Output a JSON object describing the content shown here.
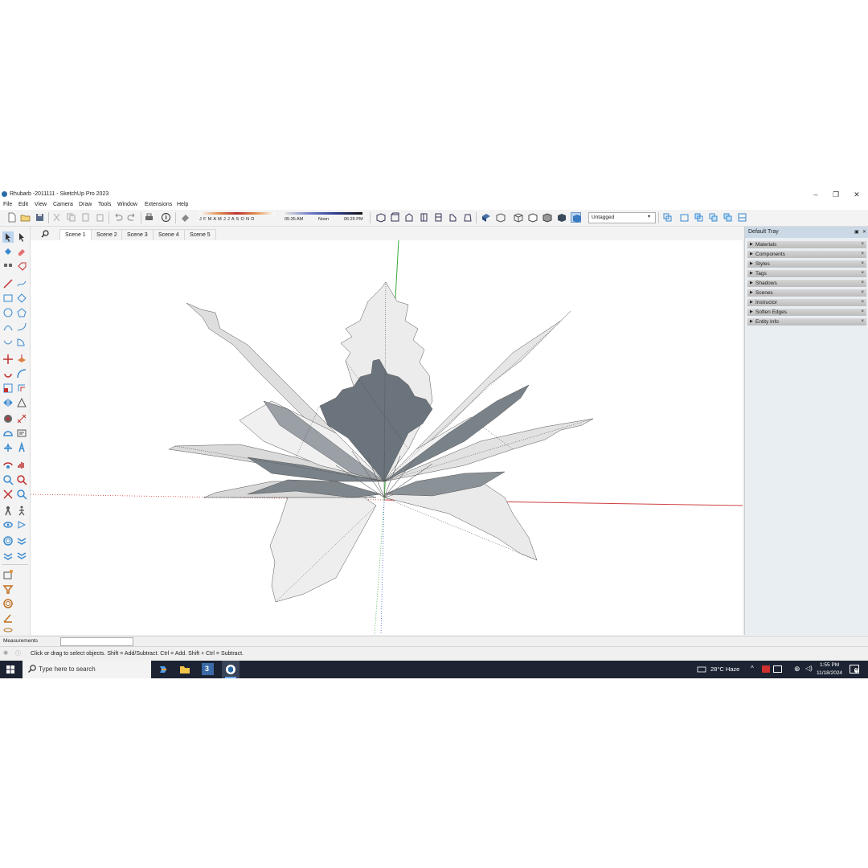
{
  "window": {
    "title": "Rhubarb -2011111 - SketchUp Pro 2023",
    "minimize": "–",
    "restore": "❐",
    "close": "✕"
  },
  "menu": [
    "File",
    "Edit",
    "View",
    "Camera",
    "Draw",
    "Tools",
    "Window",
    "Extensions",
    "Help"
  ],
  "shadows": {
    "months": "J F M A M J J A S O N D",
    "time_start": "05:35 AM",
    "time_mid": "Noon",
    "time_end": "06:25 PM"
  },
  "tag_select": {
    "value": "Untagged"
  },
  "scene_tabs": [
    "Scene 1",
    "Scene 2",
    "Scene 3",
    "Scene 4",
    "Scene 5"
  ],
  "tray": {
    "title": "Default Tray",
    "panels": [
      "Materials",
      "Components",
      "Styles",
      "Tags",
      "Shadows",
      "Scenes",
      "Instructor",
      "Soften Edges",
      "Entity Info"
    ]
  },
  "measurements": {
    "label": "Measurements",
    "value": ""
  },
  "status": {
    "hint": "Click or drag to select objects. Shift = Add/Subtract. Ctrl = Add. Shift + Ctrl = Subtract."
  },
  "taskbar": {
    "search_placeholder": "Type here to search",
    "weather": "28°C  Haze",
    "time": "1:55 PM",
    "date": "11/18/2024",
    "notifications": "4"
  },
  "colors": {
    "accent": "#2a6aa8",
    "taskbar": "#1c2333",
    "model_dark": "#6b747c",
    "model_light": "#e4e4e4",
    "axis_red": "#d04040",
    "axis_green": "#3aa83a",
    "axis_blue": "#4a6ad8"
  }
}
